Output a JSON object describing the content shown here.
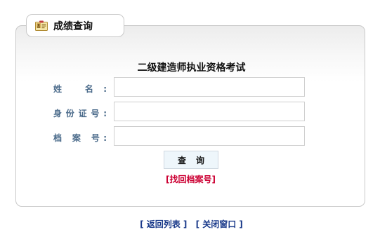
{
  "tab": {
    "title": "成绩查询",
    "icon": "id-card-icon"
  },
  "form": {
    "title": "二级建造师执业资格考试",
    "name_label": "姓 名:",
    "id_label": "身份证号:",
    "file_label": "档 案 号:",
    "name_value": "",
    "id_value": "",
    "file_value": "",
    "query_button": "查询",
    "recover_link": "[找回档案号]"
  },
  "footer": {
    "back_link": "[ 返回列表 ]",
    "close_link": "[ 关闭窗口 ]"
  },
  "colors": {
    "label": "#4a6a8a",
    "link_red": "#cc0033",
    "link_blue": "#1a3a8a",
    "border": "#c9c9c9"
  }
}
